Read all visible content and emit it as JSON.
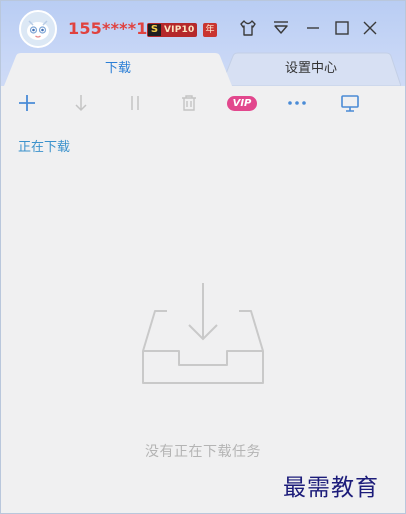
{
  "header": {
    "username": "155****1...",
    "vip_level_badge": "VIP10",
    "vip_s_badge": "S",
    "year_badge": "年"
  },
  "window_controls": [
    "skin-icon",
    "dropdown-menu-icon",
    "minimize-icon",
    "maximize-icon",
    "close-icon"
  ],
  "tabs": [
    {
      "label": "下载",
      "active": true
    },
    {
      "label": "设置中心",
      "active": false
    }
  ],
  "toolbar": {
    "vip_label": "VIP",
    "icons": [
      "add-icon",
      "download-arrow-icon",
      "pause-icon",
      "delete-icon",
      "vip-icon",
      "more-icon",
      "monitor-icon"
    ]
  },
  "section": {
    "label": "正在下载"
  },
  "empty_state": {
    "message": "没有正在下载任务"
  },
  "watermark": "最需教育",
  "colors": {
    "title_gradient": "#c7d6f6",
    "username": "#e0423f",
    "active_tab_text": "#2a7ed6",
    "section_label": "#3b92cc",
    "vip_pill": "#e2478d",
    "empty_text": "#b4b4b4"
  }
}
